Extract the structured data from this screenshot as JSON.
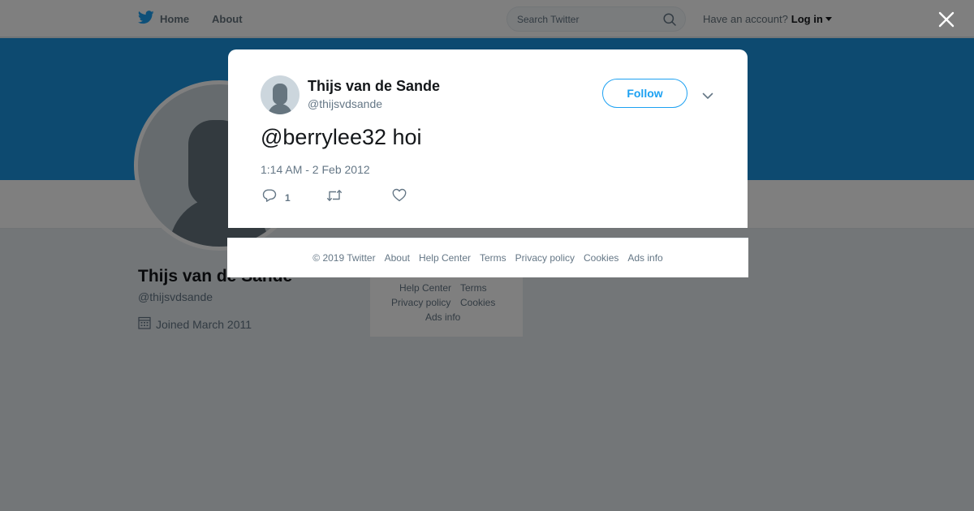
{
  "topbar": {
    "home_label": "Home",
    "about_label": "About",
    "search_placeholder": "Search Twitter",
    "account_prompt": "Have an account?",
    "login_label": "Log in"
  },
  "profile": {
    "name": "Thijs van de Sande",
    "handle": "@thijsvdsande",
    "joined": "Joined March 2011"
  },
  "side_footer": {
    "links": [
      "Help Center",
      "Terms",
      "Privacy policy",
      "Cookies",
      "Ads info"
    ]
  },
  "tweet": {
    "author_name": "Thijs van de Sande",
    "author_handle": "@thijsvdsande",
    "follow_label": "Follow",
    "text": "@berrylee32 hoi",
    "timestamp": "1:14 AM - 2 Feb 2012",
    "reply_count": "1"
  },
  "modal_footer": {
    "links": [
      "© 2019 Twitter",
      "About",
      "Help Center",
      "Terms",
      "Privacy policy",
      "Cookies",
      "Ads info"
    ]
  },
  "icons": {
    "brand": "twitter-bird-icon",
    "search": "search-icon",
    "close": "close-icon",
    "chevron": "chevron-down-icon",
    "reply": "reply-icon",
    "retweet": "retweet-icon",
    "like": "heart-icon",
    "calendar": "calendar-icon"
  },
  "colors": {
    "brand_blue": "#1da1f2",
    "banner": "#1b95e0",
    "text_secondary": "#657786"
  }
}
